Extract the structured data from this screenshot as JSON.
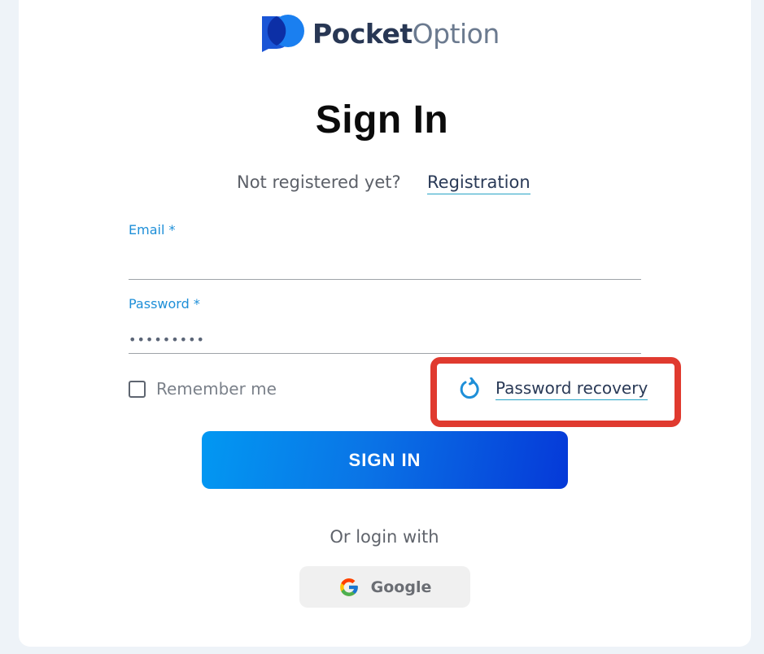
{
  "brand": {
    "name_bold": "Pocket",
    "name_light": "Option",
    "colors": {
      "dark": "#283754",
      "blue": "#1a55d6",
      "navy": "#0c2fa6"
    }
  },
  "page": {
    "title": "Sign In",
    "not_registered_text": "Not registered yet?",
    "registration_link": "Registration"
  },
  "form": {
    "email": {
      "label": "Email *",
      "value": "",
      "placeholder": ""
    },
    "password": {
      "label": "Password *",
      "value": "•••••••••"
    },
    "remember_me": {
      "label": "Remember me",
      "checked": false
    },
    "password_recovery": {
      "label": "Password recovery",
      "icon": "refresh-icon"
    },
    "submit_label": "SIGN IN"
  },
  "social": {
    "or_text": "Or login with",
    "google_label": "Google",
    "google_icon": "google-icon"
  },
  "colors": {
    "accent_blue": "#1e8fd8",
    "button_gradient_start": "#0298f2",
    "button_gradient_end": "#0539d8",
    "highlight_red": "#e03a2f"
  }
}
